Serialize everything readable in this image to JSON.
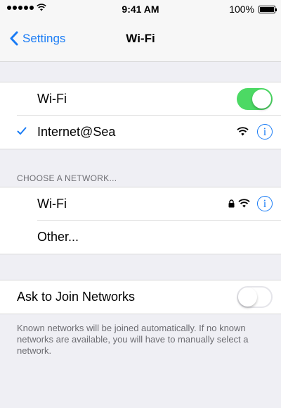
{
  "status_bar": {
    "time": "9:41 AM",
    "battery": "100%",
    "battery_level": 1.0
  },
  "nav": {
    "back_label": "Settings",
    "title": "Wi-Fi"
  },
  "wifi_group": {
    "wifi_label": "Wi-Fi",
    "wifi_on": true,
    "connected_network": "Internet@Sea"
  },
  "networks": {
    "header": "CHOOSE A NETWORK...",
    "items": [
      {
        "label": "Wi-Fi",
        "secured": true
      },
      {
        "label": "Other..."
      }
    ]
  },
  "ask_join": {
    "label": "Ask to Join Networks",
    "on": false,
    "footer": "Known networks will be joined automatically. If no known networks are available, you will have to manually select a network."
  },
  "colors": {
    "accent": "#1a7cf5",
    "toggle_on": "#4cd964",
    "background": "#efeff4"
  },
  "icons": [
    "signal-dots-icon",
    "wifi-icon",
    "battery-icon",
    "chevron-left-icon",
    "checkmark-icon",
    "lock-icon",
    "info-icon"
  ]
}
